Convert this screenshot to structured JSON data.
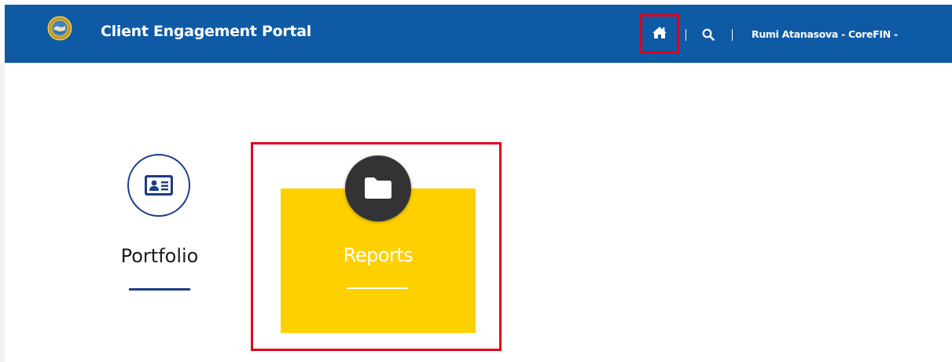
{
  "header": {
    "app_title": "Client Engagement Portal",
    "user_menu_label": "Rumi Atanasova - CoreFIN -",
    "icons": {
      "logo": "seal-logo",
      "home": "home-icon",
      "search": "search-icon"
    },
    "colors": {
      "background": "#0e5aa5",
      "text": "#ffffff",
      "highlight": "#e0001b"
    }
  },
  "tiles": [
    {
      "label": "Portfolio",
      "icon": "id-card-icon",
      "accent": "#1c3c86"
    },
    {
      "label": "Reports",
      "icon": "folder-icon",
      "background": "#ffd000",
      "icon_circle": "#333336"
    }
  ]
}
